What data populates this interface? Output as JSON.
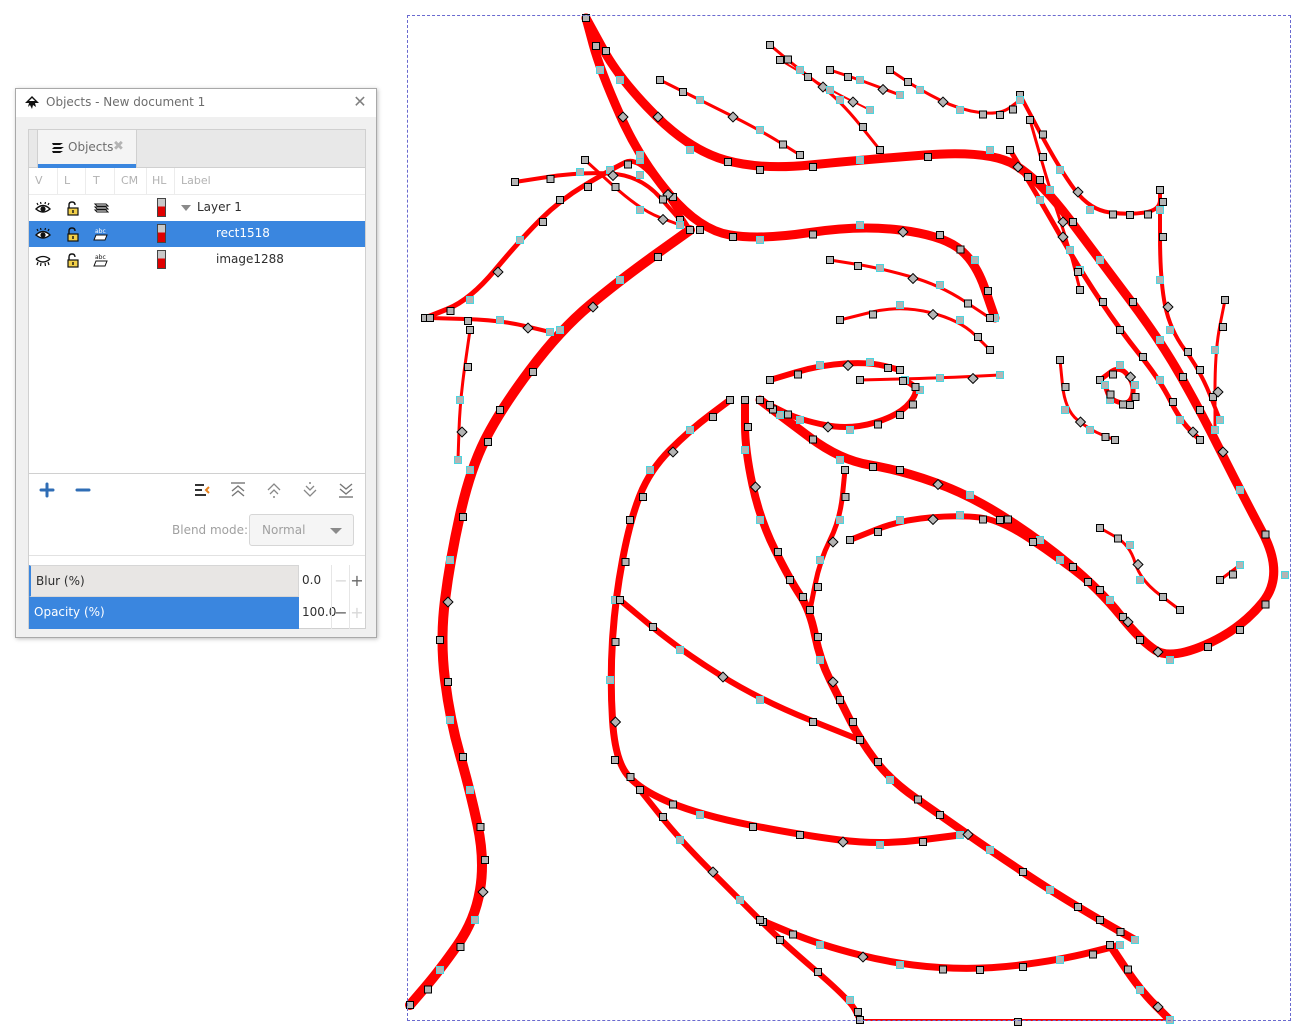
{
  "dialog": {
    "title": "Objects - New document 1",
    "close_icon": "close-icon",
    "tab": {
      "label": "Objects",
      "icon": "objects-icon",
      "close_icon": "tab-close-icon"
    },
    "columns": [
      "V",
      "L",
      "T",
      "CM",
      "HL",
      "Label"
    ],
    "rows": [
      {
        "label": "Layer 1",
        "visible": true,
        "locked": false,
        "type": "layer",
        "expanded": true,
        "selected": false,
        "highlight_color": "#e00000"
      },
      {
        "label": "rect1518",
        "visible": true,
        "locked": false,
        "type": "object",
        "selected": true,
        "highlight_color": "#e00000"
      },
      {
        "label": "image1288",
        "visible": false,
        "locked": false,
        "type": "object",
        "selected": false,
        "highlight_color": "#e00000"
      }
    ],
    "toolbar": {
      "add": "add-icon",
      "remove": "remove-icon",
      "buttons": [
        "move-to-layer-icon",
        "raise-to-top-icon",
        "raise-icon",
        "lower-icon",
        "lower-to-bottom-icon"
      ]
    },
    "blend": {
      "label": "Blend mode:",
      "value": "Normal"
    },
    "blur": {
      "label": "Blur (%)",
      "value": "0.0"
    },
    "opacity": {
      "label": "Opacity (%)",
      "value": "100.0"
    }
  },
  "canvas": {
    "stroke_color": "#ff0000",
    "node_fill": "#b4b4b4",
    "node_outline": "#000000",
    "handle_color": "#4ad6e0",
    "page_border_color": "#6a6ad0"
  }
}
